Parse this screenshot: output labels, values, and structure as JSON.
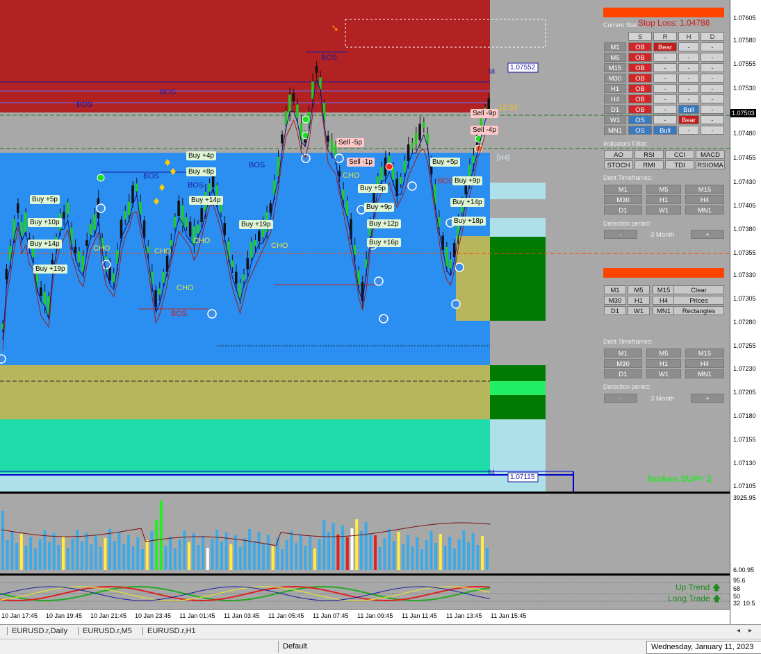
{
  "price_axis": {
    "labels": [
      "1.07605",
      "1.07580",
      "1.07555",
      "1.07530",
      "1.07480",
      "1.07455",
      "1.07430",
      "1.07405",
      "1.07380",
      "1.07355",
      "1.07330",
      "1.07305",
      "1.07280",
      "1.07255",
      "1.07230",
      "1.07205",
      "1.07180",
      "1.07155",
      "1.07130",
      "1.07105"
    ],
    "current": "1.07503",
    "volume_top": "3925.95",
    "volume_bottom": "6.00.95",
    "osc_labels": [
      "95.6",
      "68",
      "50",
      "32",
      "10.5"
    ]
  },
  "time_axis": [
    "10 Jan 17:45",
    "10 Jan 19:45",
    "10 Jan 21:45",
    "10 Jan 23:45",
    "11 Jan 01:45",
    "11 Jan 03:45",
    "11 Jan 05:45",
    "11 Jan 07:45",
    "11 Jan 09:45",
    "11 Jan 11:45",
    "11 Jan 13:45",
    "11 Jan 15:45"
  ],
  "tabs": [
    "EURUSD.r,Daily",
    "EURUSD.r,M5",
    "EURUSD.r,H1"
  ],
  "status": {
    "profile": "Default",
    "date": "Wednesday, January 11, 2023"
  },
  "chart": {
    "stop_loss": "Stop Loss: 1.04786",
    "level_top": "1.07552",
    "level_top_tag": "58",
    "level_bottom": "1.07115",
    "level_bottom_tag": "64",
    "countdown": "12:33",
    "h4_tag": "[H4]",
    "broken_sup": "broken SUP= 2",
    "up_trend": "Up Trend",
    "long_trade": "Long Trade",
    "bos": "BOS",
    "cho": "CHO",
    "buy_tags": [
      "Buy +5p",
      "Buy +10p",
      "Buy +14p",
      "Buy +19p",
      "Buy +4p",
      "Buy +8p",
      "Buy +14p",
      "Buy +19p",
      "Buy +5p",
      "Buy +9p",
      "Buy +12p",
      "Buy +16p",
      "Buy +5p",
      "Buy +9p",
      "Buy +14p",
      "Buy +18p"
    ],
    "sell_tags": [
      "Sell -5p",
      "Sell -1p",
      "Sell -9p",
      "Sell -4p"
    ]
  },
  "panel": {
    "current_status_title": "Current Stat",
    "headers": [
      "S",
      "R",
      "H",
      "D"
    ],
    "rows": [
      {
        "tf": "M1",
        "s": "OB",
        "r": "Bear",
        "h": "-",
        "d": "-"
      },
      {
        "tf": "M5",
        "s": "OB",
        "r": "-",
        "h": "-",
        "d": "-"
      },
      {
        "tf": "M15",
        "s": "OB",
        "r": "-",
        "h": "-",
        "d": "-"
      },
      {
        "tf": "M30",
        "s": "OB",
        "r": "-",
        "h": "-",
        "d": "-"
      },
      {
        "tf": "H1",
        "s": "OB",
        "r": "-",
        "h": "-",
        "d": "-"
      },
      {
        "tf": "H4",
        "s": "OB",
        "r": "-",
        "h": "-",
        "d": "-"
      },
      {
        "tf": "D1",
        "s": "OB",
        "r": "-",
        "h": "Bull",
        "d": "-"
      },
      {
        "tf": "W1",
        "s": "OS",
        "r": "-",
        "h": "Bear",
        "d": "-"
      },
      {
        "tf": "MN1",
        "s": "OS",
        "r": "Bull",
        "h": "-",
        "d": "-"
      }
    ],
    "indicators_title": "Indicators Filter:",
    "indicators": [
      "AO",
      "RSI",
      "CCI",
      "MACD",
      "STOCH",
      "RMI",
      "TDI",
      "RSIOMA"
    ],
    "debt_title": "Debt Timeframes:",
    "debt_tfs": [
      "M1",
      "M5",
      "M15",
      "M30",
      "H1",
      "H4",
      "D1",
      "W1",
      "MN1"
    ],
    "detection_title": "Detection period:",
    "detection_value": "3 Month",
    "minus": "-",
    "plus": "+",
    "tf_buttons": [
      "M1",
      "M5",
      "M15",
      "M30",
      "H1",
      "H4",
      "D1",
      "W1",
      "MN1"
    ],
    "actions": [
      "Clear",
      "Prices",
      "Rectangles"
    ]
  },
  "colors": {
    "supply": "#b22222",
    "demand": "#2a8ff0",
    "olive": "#b7b65c",
    "teal": "#20dcaa",
    "light": "#aee0ea",
    "green": "#007a00"
  }
}
